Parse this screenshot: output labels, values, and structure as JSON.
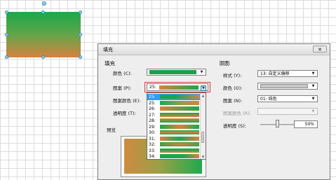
{
  "dialog": {
    "title": "填充",
    "close_icon": "✕"
  },
  "fill": {
    "section_label": "填充",
    "color_label": "颜色 (C):",
    "pattern_label": "图案 (P):",
    "pattern_color_label": "图案颜色 (E):",
    "transparency_label": "透明度 (T):",
    "pattern_value": "25:",
    "preview_label": "预览",
    "color_swatch": "#1e9e4d"
  },
  "shadow": {
    "section_label": "阴影",
    "style_label": "样式 (Y):",
    "style_value": "13: 自定义偏移",
    "color_label": "颜色 (O):",
    "pattern_label": "图案 (N):",
    "pattern_value": "01: 纯色",
    "pattern_color_label": "图案颜色 (R):",
    "transparency_label": "透明度 (S):",
    "transparency_value": "50%",
    "transparency_fraction": 0.5,
    "color_swatch": "#c8c8c8"
  },
  "pattern_list": {
    "items": [
      {
        "num": "25:",
        "selected": true
      },
      {
        "num": "25:",
        "selected": false
      },
      {
        "num": "26:",
        "selected": false
      },
      {
        "num": "27:",
        "selected": false
      },
      {
        "num": "28:",
        "selected": false
      },
      {
        "num": "29:",
        "selected": false
      },
      {
        "num": "30:",
        "selected": false
      },
      {
        "num": "31:",
        "selected": false
      },
      {
        "num": "32:",
        "selected": false
      },
      {
        "num": "33:",
        "selected": false
      },
      {
        "num": "34:",
        "selected": false
      }
    ]
  },
  "colors": {
    "green": "#19a849",
    "orange": "#d6823f",
    "highlight_red": "#e03b3b",
    "selection_blue": "#3399ff"
  }
}
